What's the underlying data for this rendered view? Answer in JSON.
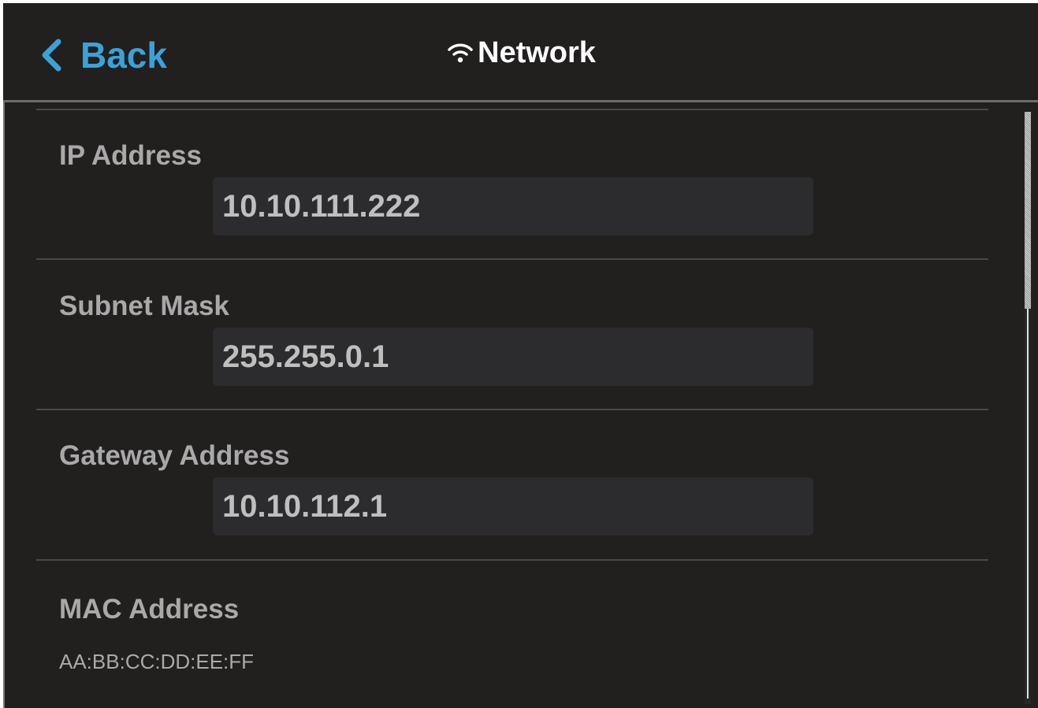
{
  "header": {
    "back_label": "Back",
    "title": "Network",
    "icons": {
      "back": "chevron-left-icon",
      "title": "wifi-icon"
    },
    "accent_color": "#3aa2d8"
  },
  "fields": [
    {
      "label": "IP Address",
      "value": "10.10.111.222"
    },
    {
      "label": "Subnet Mask",
      "value": "255.255.0.1"
    },
    {
      "label": "Gateway Address",
      "value": "10.10.112.1"
    }
  ],
  "mac": {
    "label": "MAC Address",
    "value": "AA:BB:CC:DD:EE:FF"
  }
}
